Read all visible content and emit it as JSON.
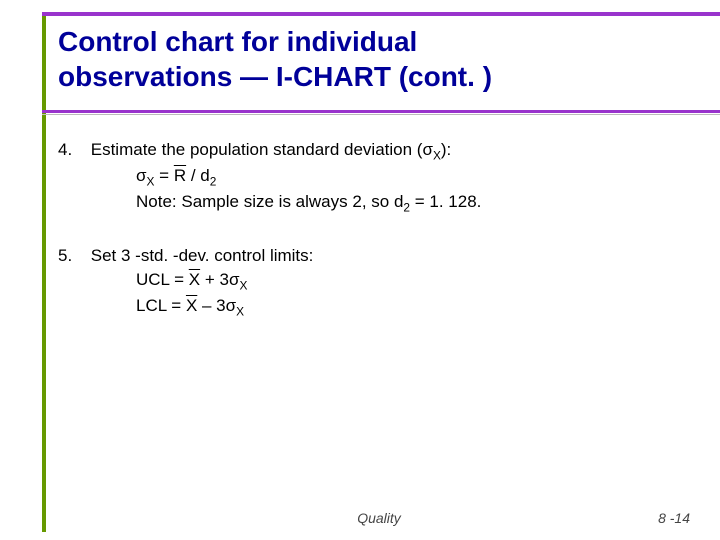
{
  "title_line1": "Control chart for individual",
  "title_line2": "observations — I-CHART (cont. )",
  "item4": {
    "number": "4.",
    "text": "Estimate the population standard deviation (σ",
    "text_sub": "X",
    "text_end": "):",
    "formula_lhs": "σ",
    "formula_sub": "X",
    "formula_eq": " = ",
    "formula_rbar": "R",
    "formula_rest": " / d",
    "formula_rest_sub": "2",
    "note_pre": "Note:  Sample size is always 2, so d",
    "note_sub": "2",
    "note_post": " = 1. 128."
  },
  "item5": {
    "number": "5.",
    "text": "Set 3 -std. -dev. control limits:",
    "ucl_label": "UCL = ",
    "ucl_xbar": "X",
    "ucl_rest": " + 3σ",
    "ucl_sub": "X",
    "lcl_label": "LCL = ",
    "lcl_xbar": "X",
    "lcl_rest": " – 3σ",
    "lcl_sub": "X"
  },
  "footer_center": "Quality",
  "footer_right": "8 -14"
}
